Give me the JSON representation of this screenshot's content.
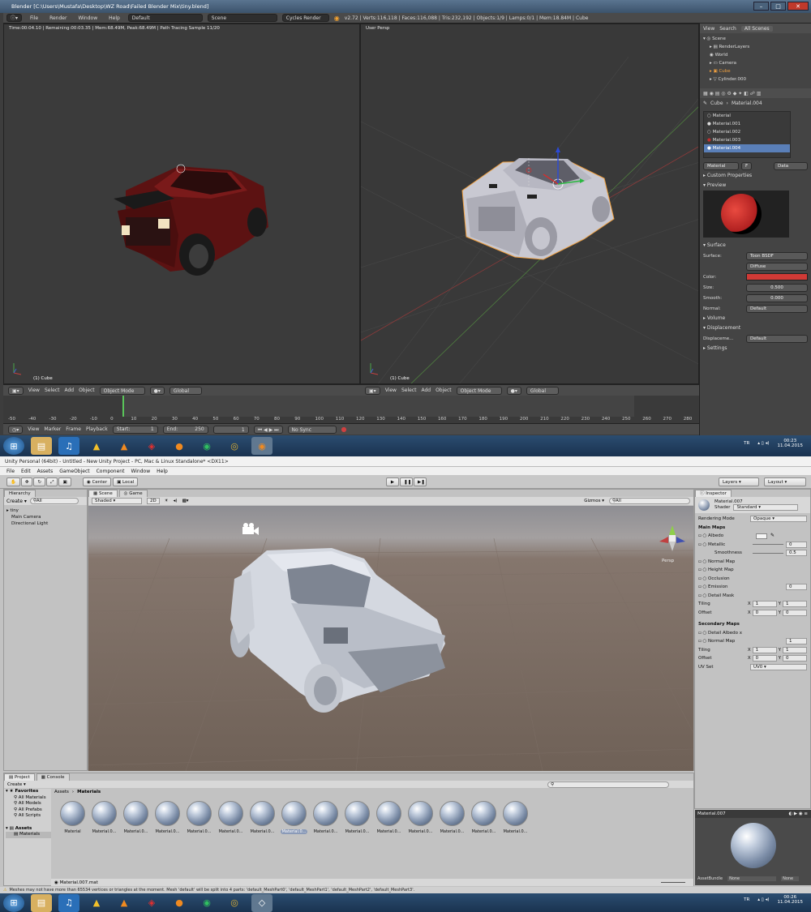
{
  "blender": {
    "window_title": "Blender [C:\\Users\\Mustafa\\Desktop\\WZ Road\\Failed Blender Mix\\tiny.blend]",
    "menu": [
      "File",
      "Render",
      "Window",
      "Help"
    ],
    "screen_layout": "Default",
    "scene": "Scene",
    "render_engine": "Cycles Render",
    "stats": "v2.72 | Verts:116,118 | Faces:116,088 | Tris:232,192 | Objects:1/9 | Lamps:0/1 | Mem:18.84M | Cube",
    "render_status": "Time:00:04.10 | Remaining:00:03.35 | Mem:68.49M, Peak:68.49M | Path Tracing Sample 11/20",
    "right_viewport_label": "User Persp",
    "left_object_label": "(1) Cube",
    "right_object_label": "(1) Cube",
    "viewport_header": {
      "items": [
        "View",
        "Select",
        "Add",
        "Object"
      ],
      "mode": "Object Mode",
      "orientation": "Global"
    },
    "timeline": {
      "ticks": [
        "-50",
        "-40",
        "-30",
        "-20",
        "-10",
        "0",
        "10",
        "20",
        "30",
        "40",
        "50",
        "60",
        "70",
        "80",
        "90",
        "100",
        "110",
        "120",
        "130",
        "140",
        "150",
        "160",
        "170",
        "180",
        "190",
        "200",
        "210",
        "220",
        "230",
        "240",
        "250",
        "260",
        "270",
        "280"
      ],
      "menu": [
        "View",
        "Marker",
        "Frame",
        "Playback"
      ],
      "start": "Start:",
      "start_val": "1",
      "end": "End:",
      "end_val": "250",
      "current": "1",
      "sync": "No Sync"
    },
    "outliner": {
      "tabs": [
        "View",
        "Search",
        "All Scenes"
      ],
      "items": [
        "Scene",
        "RenderLayers",
        "World",
        "Camera",
        "Cube",
        "Cylinder.000"
      ]
    },
    "properties": {
      "breadcrumb": [
        "Cube",
        "Material.004"
      ],
      "materials": [
        "Material",
        "Material.001",
        "Material.002",
        "Material.003",
        "Material.004"
      ],
      "material_name": "Material",
      "material_users": "F",
      "link": "Data",
      "sections": {
        "custom": "Custom Properties",
        "preview": "Preview",
        "surface": "Surface",
        "volume": "Volume",
        "displacement": "Displacement",
        "settings": "Settings"
      },
      "surface_label": "Surface:",
      "surface_value": "Toon BSDF",
      "diffuse": "Diffuse",
      "color_label": "Color:",
      "color_value": "#d03a36",
      "size_label": "Size:",
      "size_value": "0.500",
      "smooth_label": "Smooth:",
      "smooth_value": "0.000",
      "normal_label": "Normal:",
      "normal_value": "Default",
      "displacement_label": "Displaceme...",
      "displacement_value": "Default"
    },
    "taskbar": {
      "lang": "TR",
      "time": "00:23",
      "date": "11.04.2015"
    }
  },
  "unity": {
    "window_title": "Unity Personal (64bit) - Untitled - New Unity Project - PC, Mac & Linux Standalone* <DX11>",
    "menu": [
      "File",
      "Edit",
      "Assets",
      "GameObject",
      "Component",
      "Window",
      "Help"
    ],
    "pivot": "Center",
    "space": "Local",
    "layers": "Layers",
    "layout": "Layout",
    "hierarchy": {
      "tab": "Hierarchy",
      "create": "Create",
      "search": "All",
      "items": [
        "tiny",
        "Main Camera",
        "Directional Light"
      ]
    },
    "scene": {
      "tab_scene": "Scene",
      "tab_game": "Game",
      "shading": "Shaded",
      "mode2d": "2D",
      "gizmos": "Gizmos",
      "search": "All",
      "persp": "Persp"
    },
    "inspector": {
      "tab": "Inspector",
      "material": "Material.007",
      "shader_label": "Shader",
      "shader_value": "Standard",
      "rendering_mode_label": "Rendering Mode",
      "rendering_mode_value": "Opaque",
      "main_maps": "Main Maps",
      "albedo": "Albedo",
      "metallic": "Metallic",
      "metallic_val": "0",
      "smoothness": "Smoothness",
      "smoothness_val": "0.5",
      "normal_map": "Normal Map",
      "height_map": "Height Map",
      "occlusion": "Occlusion",
      "emission": "Emission",
      "emission_val": "0",
      "detail_mask": "Detail Mask",
      "tiling": "Tiling",
      "offset": "Offset",
      "x": "X",
      "y": "Y",
      "tiling_x": "1",
      "tiling_y": "1",
      "offset_x": "0",
      "offset_y": "0",
      "secondary_maps": "Secondary Maps",
      "detail_albedo": "Detail Albedo x",
      "normal_map2": "Normal Map",
      "normal_map2_val": "1",
      "tiling2_x": "1",
      "tiling2_y": "1",
      "offset2_x": "0",
      "offset2_y": "0",
      "uv_set_label": "UV Set",
      "uv_set_value": "UV0",
      "preview_title": "Material.007",
      "assetbundle_label": "AssetBundle",
      "assetbundle_value": "None",
      "assetbundle_variant": "None"
    },
    "project": {
      "tab_project": "Project",
      "tab_console": "Console",
      "create": "Create",
      "favorites": "Favorites",
      "fav_items": [
        "All Materials",
        "All Models",
        "All Prefabs",
        "All Scripts"
      ],
      "assets": "Assets",
      "asset_items": [
        "Materials"
      ],
      "breadcrumb": [
        "Assets",
        "Materials"
      ],
      "materials": [
        "Material",
        "Material.0...",
        "Material.0...",
        "Material.0...",
        "Material.0...",
        "Material.0...",
        "Material.0...",
        "Material.0...",
        "Material.0...",
        "Material.0...",
        "Material.0...",
        "Material.0...",
        "Material.0...",
        "Material.0...",
        "Material.0..."
      ],
      "selected_file": "Material.007.mat"
    },
    "status": "Meshes may not have more than 65534 vertices or triangles at the moment. Mesh 'default' will be split into 4 parts: 'default_MeshPart0', 'default_MeshPart1', 'default_MeshPart2', 'default_MeshPart3'.",
    "taskbar": {
      "lang": "TR",
      "time": "00:26",
      "date": "11.04.2015"
    }
  }
}
